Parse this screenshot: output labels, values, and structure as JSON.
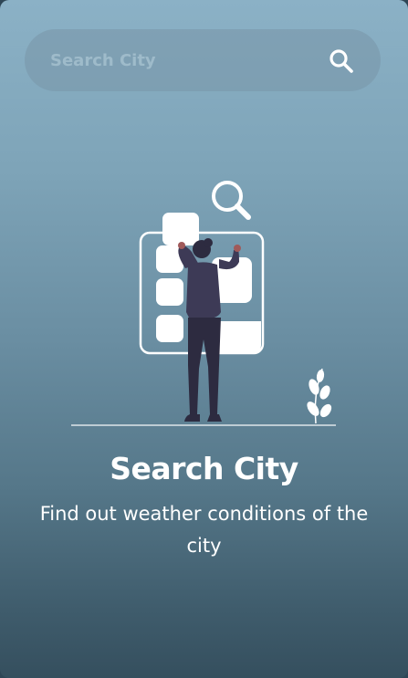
{
  "search": {
    "placeholder": "Search City",
    "value": ""
  },
  "icons": {
    "search": "search-icon",
    "illustration": "person-searching-illustration"
  },
  "empty_state": {
    "title": "Search City",
    "description": "Find out weather conditions of the city"
  },
  "colors": {
    "gradient_top": "#8bb1c6",
    "gradient_bottom": "#354f5e",
    "text": "#ffffff",
    "search_bar_bg": "#7896a8"
  }
}
